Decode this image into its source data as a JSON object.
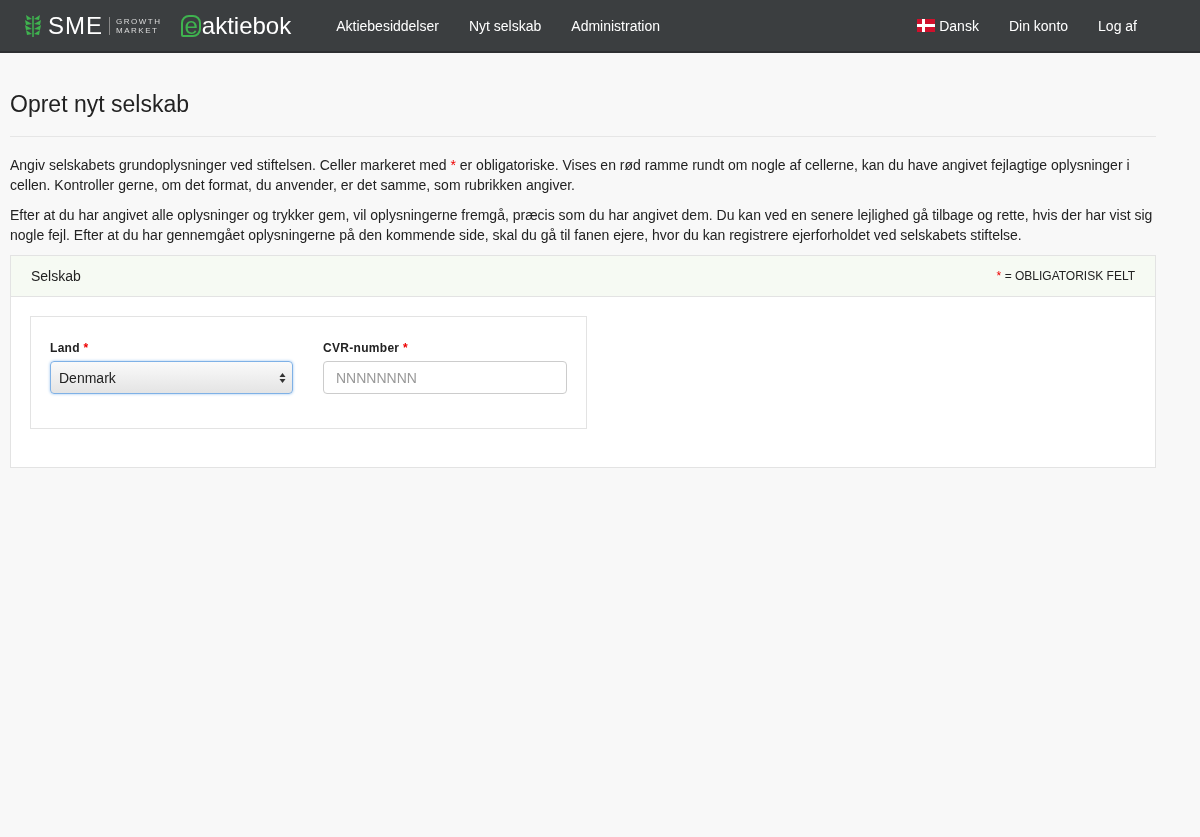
{
  "navbar": {
    "brand": {
      "name": "SME",
      "tagline_1": "GROWTH",
      "tagline_2": "MARKET",
      "product_mark": "e",
      "product": "aktiebok"
    },
    "links": [
      {
        "label": "Aktiebesiddelser"
      },
      {
        "label": "Nyt selskab"
      },
      {
        "label": "Administration"
      }
    ],
    "right_links": [
      {
        "label": "Dansk",
        "kind": "language"
      },
      {
        "label": "Din konto",
        "kind": "link"
      },
      {
        "label": "Log af",
        "kind": "link"
      }
    ]
  },
  "page_title": "Opret nyt selskab",
  "intro": {
    "before": "Angiv selskabets grundoplysninger ved stiftelsen. Celler markeret med ",
    "mark": "*",
    "after": " er obligatoriske. Vises en rød ramme rundt om nogle af cellerne, kan du have angivet fejlagtige oplysninger i cellen. Kontroller gerne, om det format, du anvender, er det samme, som rubrikken angiver."
  },
  "paragraph": "Efter at du har angivet alle oplysninger og trykker gem, vil oplysningerne fremgå, præcis som du har angivet dem. Du kan ved en senere lejlighed gå tilbage og rette, hvis der har vist sig nogle fejl. Efter at du har gennemgået oplysningerne på den kommende side, skal du gå til fanen ejere, hvor du kan registrere ejerforholdet ved selskabets stiftelse.",
  "panel": {
    "title": "Selskab",
    "legend_mark": "*",
    "legend": "= OBLIGATORISK FELT",
    "fields": [
      {
        "label": "Land",
        "required_mark": "*",
        "kind": "select",
        "value": "Denmark",
        "focused": true
      },
      {
        "label": "CVR-number",
        "required_mark": "*",
        "kind": "text",
        "placeholder": "NNNNNNNN",
        "focused": false
      }
    ]
  }
}
